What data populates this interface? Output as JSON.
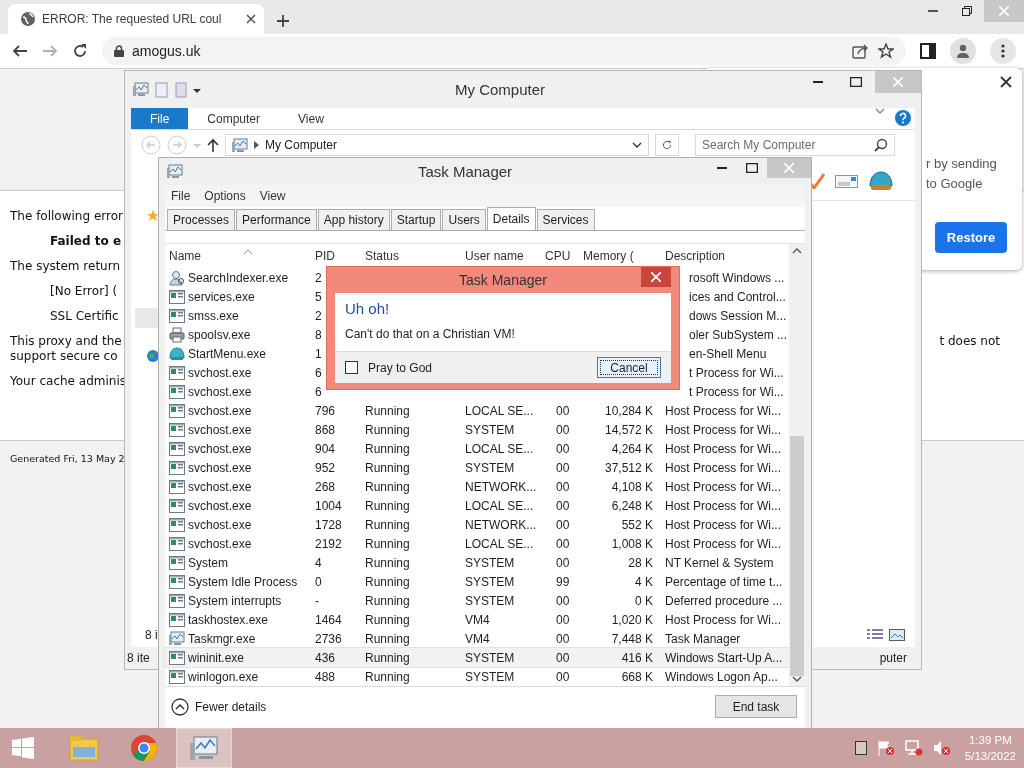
{
  "browser": {
    "tab": {
      "title": "ERROR: The requested URL coul"
    },
    "address": "amogus.uk"
  },
  "page": {
    "paragraphs": [
      {
        "kind": "plain",
        "text": "The following error"
      },
      {
        "kind": "bold",
        "text": "Failed to e"
      },
      {
        "kind": "plain",
        "text": "The system return"
      },
      {
        "kind": "indent",
        "text": "[No Error] ("
      },
      {
        "kind": "indent",
        "text": "SSL Certific"
      },
      {
        "kind": "plain",
        "text": "This proxy and the",
        "right": "t does not"
      },
      {
        "kind": "cont",
        "text": "support secure co"
      },
      {
        "kind": "plain",
        "text": "Your cache adminis"
      }
    ],
    "footer": "Generated Fri, 13 May 2"
  },
  "popup": {
    "lines": [
      "r by sending",
      "to Google"
    ],
    "button": "Restore"
  },
  "explorer": {
    "title": "My Computer",
    "ribbon_tabs": [
      {
        "label": "File",
        "selected": true
      },
      {
        "label": "Computer",
        "selected": false
      },
      {
        "label": "View",
        "selected": false
      }
    ],
    "breadcrumb": "My Computer",
    "search": {
      "placeholder": "Search My Computer"
    },
    "item_count": "8 i",
    "status_count": "8 ite",
    "status_right": "puter"
  },
  "task_manager": {
    "title": "Task Manager",
    "menu": [
      "File",
      "Options",
      "View"
    ],
    "tabs": [
      {
        "label": "Processes",
        "selected": false
      },
      {
        "label": "Performance",
        "selected": false
      },
      {
        "label": "App history",
        "selected": false
      },
      {
        "label": "Startup",
        "selected": false
      },
      {
        "label": "Users",
        "selected": false
      },
      {
        "label": "Details",
        "selected": true
      },
      {
        "label": "Services",
        "selected": false
      }
    ],
    "columns": [
      "Name",
      "PID",
      "Status",
      "User name",
      "CPU",
      "Memory (",
      "Description"
    ],
    "rows": [
      {
        "kind": "search",
        "name": "SearchIndexer.exe",
        "pid": "2",
        "description": "rosoft Windows ...",
        "selected": false
      },
      {
        "kind": "app",
        "name": "services.exe",
        "pid": "5",
        "description": "ices and Control...",
        "selected": false
      },
      {
        "kind": "app",
        "name": "smss.exe",
        "pid": "2",
        "description": "dows Session M...",
        "selected": false
      },
      {
        "kind": "printer",
        "name": "spoolsv.exe",
        "pid": "8",
        "description": "oler SubSystem ...",
        "selected": false
      },
      {
        "kind": "shell",
        "name": "StartMenu.exe",
        "pid": "1",
        "description": "en-Shell Menu",
        "selected": false
      },
      {
        "kind": "app",
        "name": "svchost.exe",
        "pid": "6",
        "description": "t Process for Wi...",
        "selected": false
      },
      {
        "kind": "app",
        "name": "svchost.exe",
        "pid": "6",
        "description": "t Process for Wi...",
        "selected": false
      },
      {
        "kind": "app",
        "name": "svchost.exe",
        "pid": "796",
        "status": "Running",
        "user": "LOCAL SE...",
        "cpu": "00",
        "memory": "10,284 K",
        "description": "Host Process for Wi...",
        "selected": false
      },
      {
        "kind": "app",
        "name": "svchost.exe",
        "pid": "868",
        "status": "Running",
        "user": "SYSTEM",
        "cpu": "00",
        "memory": "14,572 K",
        "description": "Host Process for Wi...",
        "selected": false
      },
      {
        "kind": "app",
        "name": "svchost.exe",
        "pid": "904",
        "status": "Running",
        "user": "LOCAL SE...",
        "cpu": "00",
        "memory": "4,264 K",
        "description": "Host Process for Wi...",
        "selected": false
      },
      {
        "kind": "app",
        "name": "svchost.exe",
        "pid": "952",
        "status": "Running",
        "user": "SYSTEM",
        "cpu": "00",
        "memory": "37,512 K",
        "description": "Host Process for Wi...",
        "selected": false
      },
      {
        "kind": "app",
        "name": "svchost.exe",
        "pid": "268",
        "status": "Running",
        "user": "NETWORK...",
        "cpu": "00",
        "memory": "4,108 K",
        "description": "Host Process for Wi...",
        "selected": false
      },
      {
        "kind": "app",
        "name": "svchost.exe",
        "pid": "1004",
        "status": "Running",
        "user": "LOCAL SE...",
        "cpu": "00",
        "memory": "6,248 K",
        "description": "Host Process for Wi...",
        "selected": false
      },
      {
        "kind": "app",
        "name": "svchost.exe",
        "pid": "1728",
        "status": "Running",
        "user": "NETWORK...",
        "cpu": "00",
        "memory": "552 K",
        "description": "Host Process for Wi...",
        "selected": false
      },
      {
        "kind": "app",
        "name": "svchost.exe",
        "pid": "2192",
        "status": "Running",
        "user": "LOCAL SE...",
        "cpu": "00",
        "memory": "1,008 K",
        "description": "Host Process for Wi...",
        "selected": false
      },
      {
        "kind": "app",
        "name": "System",
        "pid": "4",
        "status": "Running",
        "user": "SYSTEM",
        "cpu": "00",
        "memory": "28 K",
        "description": "NT Kernel & System",
        "selected": false
      },
      {
        "kind": "app",
        "name": "System Idle Process",
        "pid": "0",
        "status": "Running",
        "user": "SYSTEM",
        "cpu": "99",
        "memory": "4 K",
        "description": "Percentage of time t...",
        "selected": false
      },
      {
        "kind": "app",
        "name": "System interrupts",
        "pid": "-",
        "status": "Running",
        "user": "SYSTEM",
        "cpu": "00",
        "memory": "0 K",
        "description": "Deferred procedure ...",
        "selected": false
      },
      {
        "kind": "app",
        "name": "taskhostex.exe",
        "pid": "1464",
        "status": "Running",
        "user": "VM4",
        "cpu": "00",
        "memory": "1,020 K",
        "description": "Host Process for Wi...",
        "selected": false
      },
      {
        "kind": "taskmgr",
        "name": "Taskmgr.exe",
        "pid": "2736",
        "status": "Running",
        "user": "VM4",
        "cpu": "00",
        "memory": "7,448 K",
        "description": "Task Manager",
        "selected": false
      },
      {
        "kind": "app",
        "name": "wininit.exe",
        "pid": "436",
        "status": "Running",
        "user": "SYSTEM",
        "cpu": "00",
        "memory": "416 K",
        "description": "Windows Start-Up A...",
        "selected": true
      },
      {
        "kind": "app",
        "name": "winlogon.exe",
        "pid": "488",
        "status": "Running",
        "user": "SYSTEM",
        "cpu": "00",
        "memory": "668 K",
        "description": "Windows Logon Ap...",
        "selected": false
      }
    ],
    "footer_link": "Fewer details",
    "end_task": "End task"
  },
  "dialog": {
    "title": "Task Manager",
    "heading": "Uh oh!",
    "message": "Can't do that on a Christian VM!",
    "checkbox": {
      "label": "Pray to God",
      "checked": false
    },
    "button": "Cancel"
  },
  "taskbar": {
    "apps": [
      {
        "kind": "explorer",
        "selected": false
      },
      {
        "kind": "chrome",
        "selected": false
      },
      {
        "kind": "taskmgr",
        "selected": true
      }
    ],
    "time": "1:39 PM",
    "date": "5/13/2022"
  }
}
